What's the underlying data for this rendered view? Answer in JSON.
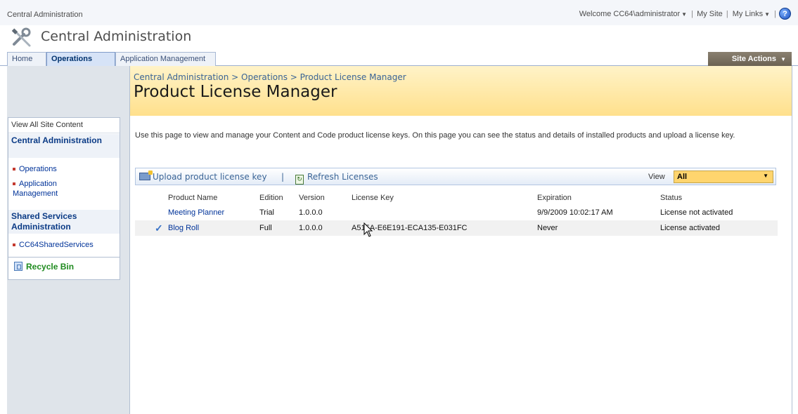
{
  "topbar": {
    "site_name": "Central Administration",
    "welcome": "Welcome CC64\\administrator",
    "my_site": "My Site",
    "my_links": "My Links"
  },
  "header": {
    "site_title": "Central Administration"
  },
  "tabs": {
    "home": "Home",
    "operations": "Operations",
    "app_mgmt": "Application Management",
    "site_actions": "Site Actions"
  },
  "leftnav": {
    "view_all": "View All Site Content",
    "section1": "Central Administration",
    "item_operations": "Operations",
    "item_app_mgmt": "Application Management",
    "section2": "Shared Services Administration",
    "item_shared": "CC64SharedServices",
    "recycle_bin": "Recycle Bin"
  },
  "page": {
    "breadcrumb": "Central Administration > Operations > Product License Manager",
    "title": "Product License Manager",
    "description": "Use this page to view and manage your Content and Code product license keys. On this page you can see the status and details of installed products and upload a license key."
  },
  "toolbar": {
    "upload": "Upload product license key",
    "refresh": "Refresh Licenses",
    "view_label": "View",
    "view_value": "All"
  },
  "table": {
    "headers": [
      "Product Name",
      "Edition",
      "Version",
      "License Key",
      "Expiration",
      "Status"
    ],
    "rows": [
      {
        "checked": "",
        "name": "Meeting Planner",
        "edition": "Trial",
        "version": "1.0.0.0",
        "key": "",
        "expiration": "9/9/2009 10:02:17 AM",
        "status": "License not activated"
      },
      {
        "checked": "✓",
        "name": "Blog Roll",
        "edition": "Full",
        "version": "1.0.0.0",
        "key": "A515A-E6E191-ECA135-E031FC",
        "expiration": "Never",
        "status": "License activated"
      }
    ]
  },
  "icons": [
    "tools-icon",
    "help-icon",
    "upload-icon",
    "refresh-icon",
    "recycle-bin-icon",
    "check-icon",
    "dropdown-arrow-icon",
    "mouse-cursor-icon"
  ],
  "colors": {
    "header_band": "#ffe08c",
    "link": "#003399",
    "site_actions": "#6b6253"
  }
}
